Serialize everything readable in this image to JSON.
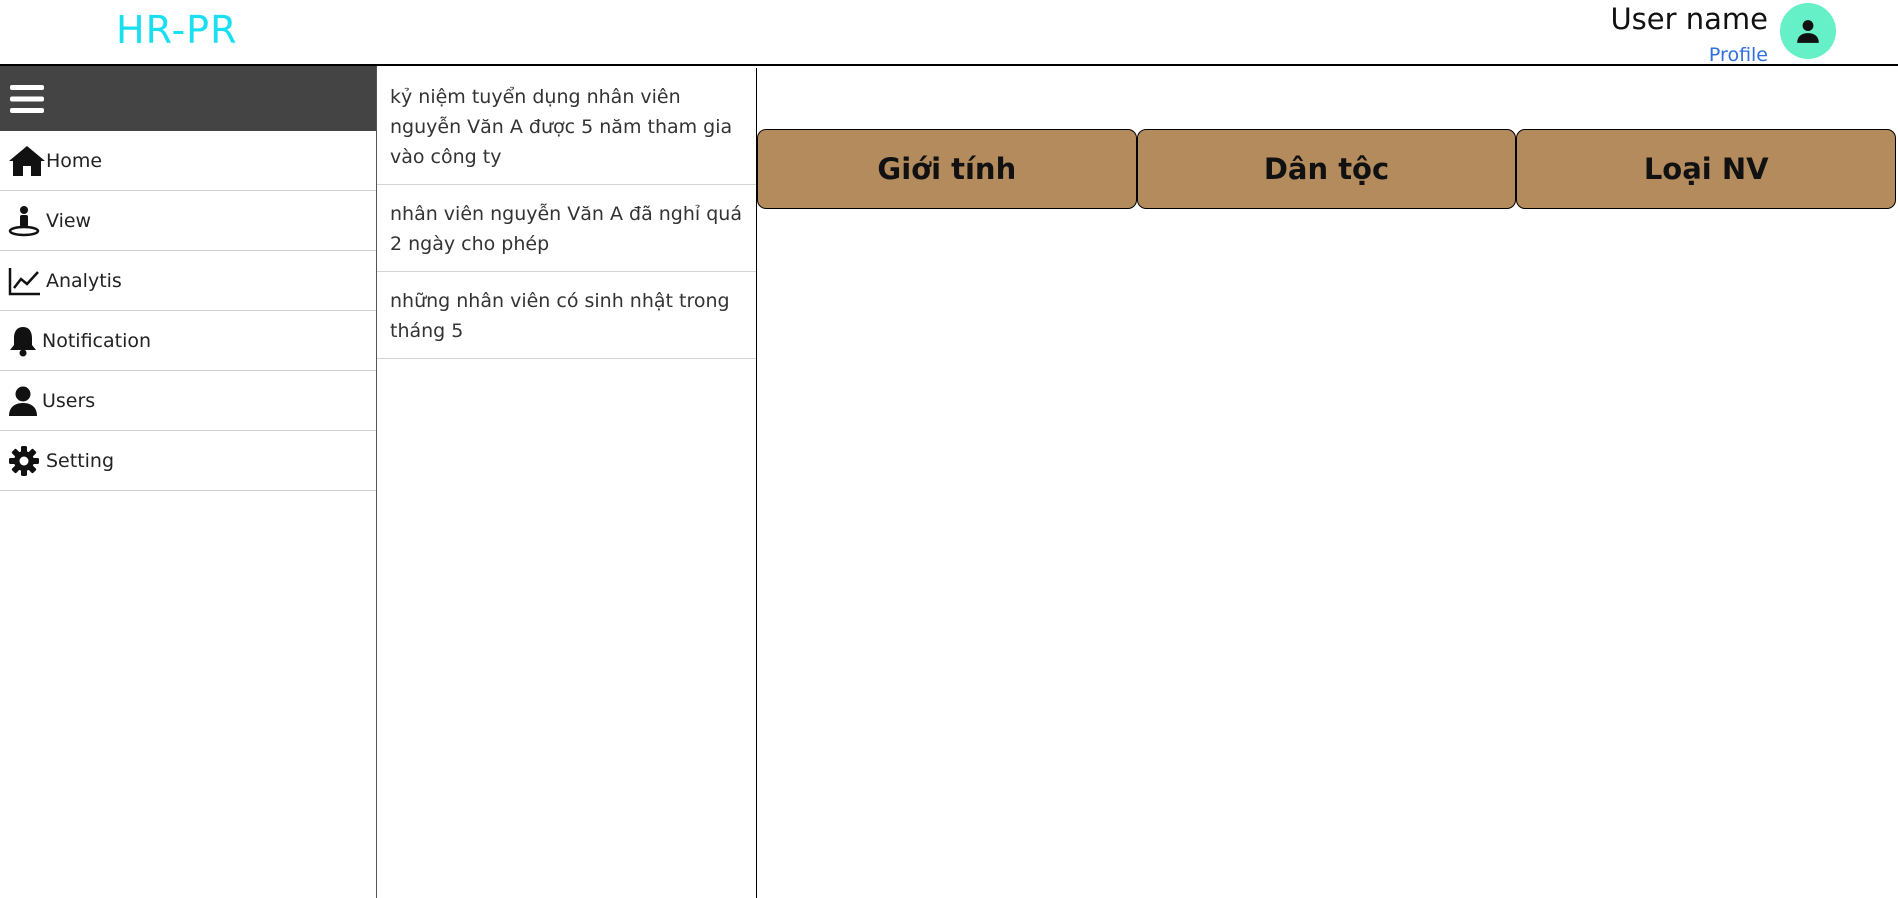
{
  "header": {
    "brand": "HR-PR",
    "user_name": "User name",
    "profile_link": "Profile",
    "avatar_icon": "person-icon",
    "avatar_color": "#66f0c8"
  },
  "sidebar": {
    "menu_icon": "hamburger-menu-icon",
    "items": [
      {
        "label": "Home",
        "icon": "home-icon"
      },
      {
        "label": "View",
        "icon": "person-pin-icon"
      },
      {
        "label": "Analytis",
        "icon": "chart-line-icon"
      },
      {
        "label": "Notification",
        "icon": "bell-icon"
      },
      {
        "label": "Users",
        "icon": "user-icon"
      },
      {
        "label": "Setting",
        "icon": "gear-icon"
      }
    ]
  },
  "notifications": [
    {
      "text": "kỷ niệm tuyển dụng nhân viên nguyễn Văn A được 5 năm tham gia vào công ty"
    },
    {
      "text": "nhân viên nguyễn Văn A đã nghỉ quá 2 ngày cho phép"
    },
    {
      "text": "những nhân viên có sinh nhật trong tháng 5"
    }
  ],
  "tabs": [
    {
      "label": "Giới tính"
    },
    {
      "label": "Dân tộc"
    },
    {
      "label": "Loại NV"
    }
  ],
  "colors": {
    "brand": "#19e0f0",
    "sidebar_top": "#444444",
    "tab_bg": "#b38b5d",
    "link": "#2f6fdf"
  }
}
